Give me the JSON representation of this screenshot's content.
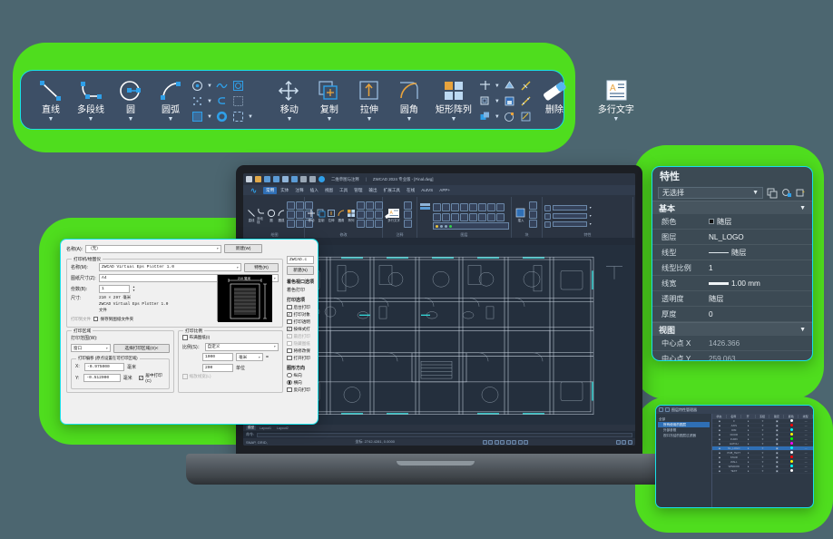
{
  "page": {
    "background_color": "#4c6670",
    "accent_green": "#4fdd1e",
    "accent_cyan": "#18e0e8"
  },
  "toolbar": {
    "groups": [
      {
        "name": "draw",
        "big_tools": [
          {
            "label": "直线",
            "icon": "line-icon",
            "has_dropdown": true
          },
          {
            "label": "多段线",
            "icon": "polyline-icon",
            "has_dropdown": true
          },
          {
            "label": "圆",
            "icon": "circle-icon",
            "has_dropdown": true
          },
          {
            "label": "圆弧",
            "icon": "arc-icon",
            "has_dropdown": true
          }
        ],
        "mini_tools": [
          {
            "icon": "point-icon",
            "has_dropdown": true
          },
          {
            "icon": "spline-icon",
            "has_dropdown": false
          },
          {
            "icon": "region-icon",
            "has_dropdown": false
          },
          {
            "icon": "divide-icon",
            "has_dropdown": true
          },
          {
            "icon": "revision-cloud-icon",
            "has_dropdown": false
          },
          {
            "icon": "wipeout-icon",
            "has_dropdown": false
          },
          {
            "icon": "hatch-icon",
            "has_dropdown": true
          },
          {
            "icon": "donut-icon",
            "has_dropdown": false
          },
          {
            "icon": "boundary-icon",
            "has_dropdown": true
          }
        ]
      },
      {
        "name": "modify",
        "big_tools": [
          {
            "label": "移动",
            "icon": "move-icon",
            "has_dropdown": true
          },
          {
            "label": "复制",
            "icon": "copy-icon",
            "has_dropdown": true
          },
          {
            "label": "拉伸",
            "icon": "stretch-icon",
            "has_dropdown": true
          },
          {
            "label": "圆角",
            "icon": "fillet-icon",
            "has_dropdown": true
          },
          {
            "label": "矩形阵列",
            "icon": "rectangular-array-icon",
            "has_dropdown": true
          }
        ],
        "mini_tools": [
          {
            "icon": "trim-icon",
            "has_dropdown": true
          },
          {
            "icon": "explode-icon",
            "has_dropdown": false
          },
          {
            "icon": "edit-polyline-icon",
            "has_dropdown": false
          },
          {
            "icon": "offset-icon",
            "has_dropdown": true
          },
          {
            "icon": "block-icon",
            "has_dropdown": false
          },
          {
            "icon": "edit-spline-icon",
            "has_dropdown": false
          },
          {
            "icon": "mirror-icon",
            "has_dropdown": true
          },
          {
            "icon": "gradient-icon",
            "has_dropdown": false
          },
          {
            "icon": "edit-hatch-icon",
            "has_dropdown": false
          }
        ],
        "eraser": {
          "label": "删除",
          "icon": "eraser-icon"
        }
      },
      {
        "name": "annotate",
        "big_tools": [
          {
            "label": "多行文字",
            "icon": "mtext-icon",
            "has_dropdown": true
          }
        ],
        "mini_tools": []
      }
    ]
  },
  "cad_window": {
    "title": "ZWCAD 2024 专业版 - [Final.dwg]",
    "workspace_selector": "二维草图与注释",
    "quick_access": [
      "new-icon",
      "open-icon",
      "save-icon",
      "saveas-icon",
      "plot-icon",
      "plot-preview-icon",
      "undo-icon",
      "redo-icon"
    ],
    "ribbon_tabs": [
      {
        "label": "常用",
        "active": true
      },
      {
        "label": "实体",
        "active": false
      },
      {
        "label": "注释",
        "active": false
      },
      {
        "label": "插入",
        "active": false
      },
      {
        "label": "视图",
        "active": false
      },
      {
        "label": "工具",
        "active": false
      },
      {
        "label": "管理",
        "active": false
      },
      {
        "label": "输出",
        "active": false
      },
      {
        "label": "扩展工具",
        "active": false
      },
      {
        "label": "在线",
        "active": false
      },
      {
        "label": "AutVS",
        "active": false
      },
      {
        "label": "APP+",
        "active": false
      }
    ],
    "ribbon_panels": [
      {
        "name": "绘图",
        "buttons": [
          {
            "label": "直线",
            "icon": "line-icon"
          },
          {
            "label": "多段线",
            "icon": "polyline-icon"
          },
          {
            "label": "圆",
            "icon": "circle-icon"
          },
          {
            "label": "圆弧",
            "icon": "arc-icon"
          }
        ]
      },
      {
        "name": "修改",
        "buttons": [
          {
            "label": "移动",
            "icon": "move-icon"
          },
          {
            "label": "复制",
            "icon": "copy-icon"
          },
          {
            "label": "拉伸",
            "icon": "stretch-icon"
          },
          {
            "label": "圆角",
            "icon": "fillet-icon"
          },
          {
            "label": "阵列",
            "icon": "array-icon"
          }
        ]
      },
      {
        "name": "注释",
        "buttons": [
          {
            "label": "多行文字",
            "icon": "mtext-icon"
          }
        ]
      },
      {
        "name": "图层",
        "buttons": [
          {
            "label": "图层特性",
            "icon": "layer-properties-icon"
          }
        ]
      },
      {
        "name": "块",
        "buttons": [
          {
            "label": "插入",
            "icon": "insert-block-icon"
          }
        ]
      },
      {
        "name": "特性",
        "buttons": []
      }
    ],
    "document_tab": "[-][俯视][二维线框][着色]",
    "layout_tabs": [
      {
        "label": "模型",
        "active": true
      },
      {
        "label": "Layout1",
        "active": false
      },
      {
        "label": "Layout2",
        "active": false
      }
    ],
    "command_prompt": "命令:",
    "status_coords": "坐标: 2742.4281, 0.0000",
    "status_left": "SNAP, GRID,"
  },
  "print_dialog": {
    "page_setup": {
      "label": "页面设置",
      "name_label": "名称(A):",
      "name_value": "〈无〉",
      "add_button": "新建(W)"
    },
    "printer": {
      "group_title": "打印机/绘图仪",
      "name_label": "名称(M):",
      "name_value": "ZWCAD Virtual Eps Plotter 1.0",
      "properties_button": "特性(R)",
      "paper_label": "图纸尺寸(Z):",
      "paper_value": "A4",
      "copies_label": "份数(B):",
      "copies_value": "1",
      "size_label": "尺寸:",
      "size_value": "210 × 297  毫米",
      "device_line": "ZWCAD Virtual Eps Plotter 1.0",
      "file_line": "文件",
      "print_to_file_label": "打印到文件",
      "save_checkbox": "保存到图纸文件夹",
      "save_checked": false
    },
    "area": {
      "group_title": "打印区域",
      "what_label": "打印范围(W):",
      "what_value": "窗口",
      "window_button": "选择打印区域(O)<",
      "offset_title": "打印偏移 (原点设置在可打印区域)",
      "x_label": "X:",
      "x_value": "-0.975000",
      "x_unit": "毫米",
      "y_label": "Y:",
      "y_value": "-0.512000",
      "y_unit": "毫米",
      "center_checkbox": "居中打印(C)",
      "center_checked": true
    },
    "scale": {
      "group_title": "打印比例",
      "fit_checkbox": "布满图纸(I)",
      "fit_checked": false,
      "scale_label": "比例(S)：",
      "scale_value": "自定义",
      "num_value": "1000",
      "num_unit": "毫米",
      "equals": "=",
      "den_value": "200",
      "den_unit": "单位",
      "lineweight_checkbox": "缩放线宽(L)",
      "lineweight_checked": false
    },
    "right_panel": {
      "style_value": "ZWCAD.c",
      "new_button": "新建(N)",
      "shaded_title": "着色视口选项",
      "shaded_label": "着色打印",
      "options_title": "打印选项",
      "options": [
        {
          "label": "后台打印",
          "checked": false,
          "disabled": false
        },
        {
          "label": "打印对象",
          "checked": true,
          "disabled": false
        },
        {
          "label": "打印透明",
          "checked": false,
          "disabled": false
        },
        {
          "label": "按样式打",
          "checked": true,
          "disabled": false
        },
        {
          "label": "最后打印",
          "checked": true,
          "disabled": true
        },
        {
          "label": "隐藏图纸",
          "checked": false,
          "disabled": true
        },
        {
          "label": "将修改保",
          "checked": false,
          "disabled": false
        },
        {
          "label": "打开打印",
          "checked": false,
          "disabled": false
        }
      ],
      "orientation_title": "图形方向",
      "orientations": [
        {
          "label": "纵向",
          "selected": false
        },
        {
          "label": "横向",
          "selected": true
        }
      ],
      "upside_down": {
        "label": "反向打印",
        "checked": false
      }
    }
  },
  "properties_panel": {
    "title": "特性",
    "selection_value": "无选择",
    "header_icons": [
      "quick-select-icon",
      "select-objects-icon",
      "toggle-value-icon"
    ],
    "sections": [
      {
        "title": "基本",
        "rows": [
          {
            "key": "颜色",
            "value": "随层",
            "type": "color"
          },
          {
            "key": "图层",
            "value": "NL_LOGO",
            "type": "text"
          },
          {
            "key": "线型",
            "value": "随层",
            "type": "linetype"
          },
          {
            "key": "线型比例",
            "value": "1",
            "type": "text"
          },
          {
            "key": "线宽",
            "value": "1.00 mm",
            "type": "lineweight"
          },
          {
            "key": "透明度",
            "value": "随层",
            "type": "text"
          },
          {
            "key": "厚度",
            "value": "0",
            "type": "text"
          }
        ]
      },
      {
        "title": "视图",
        "rows": [
          {
            "key": "中心点 X",
            "value": "1426.366",
            "type": "dim"
          },
          {
            "key": "中心点 Y",
            "value": "259.063",
            "type": "dim"
          }
        ]
      }
    ]
  },
  "layer_manager": {
    "title": "图层特性管理器",
    "tree": [
      {
        "label": "全部",
        "selected": false,
        "indent": 0
      },
      {
        "label": "所有使用的图层",
        "selected": true,
        "indent": 1
      },
      {
        "label": "外部参照",
        "selected": false,
        "indent": 1
      },
      {
        "label": "视口冻结的图层过滤器",
        "selected": false,
        "indent": 1
      }
    ],
    "columns": [
      "状态",
      "名称",
      "开",
      "冻结",
      "锁定",
      "颜色",
      "线型"
    ],
    "rows": [
      {
        "name": "0",
        "color": "#ffffff",
        "selected": false
      },
      {
        "name": "AXIS",
        "color": "#ff0000",
        "selected": false
      },
      {
        "name": "DIM",
        "color": "#00ffff",
        "selected": false
      },
      {
        "name": "DOOR",
        "color": "#ffff00",
        "selected": false
      },
      {
        "name": "FURN",
        "color": "#00ff00",
        "selected": false
      },
      {
        "name": "HATCH",
        "color": "#ff00ff",
        "selected": false
      },
      {
        "name": "NL_LOGO",
        "color": "#00ffff",
        "selected": true
      },
      {
        "name": "PUB_TEXT",
        "color": "#ffffff",
        "selected": false
      },
      {
        "name": "STAIR",
        "color": "#ff0000",
        "selected": false
      },
      {
        "name": "WALL",
        "color": "#ffff00",
        "selected": false
      },
      {
        "name": "WINDOW",
        "color": "#00ffff",
        "selected": false
      },
      {
        "name": "TEXT",
        "color": "#ffffff",
        "selected": false
      }
    ]
  }
}
